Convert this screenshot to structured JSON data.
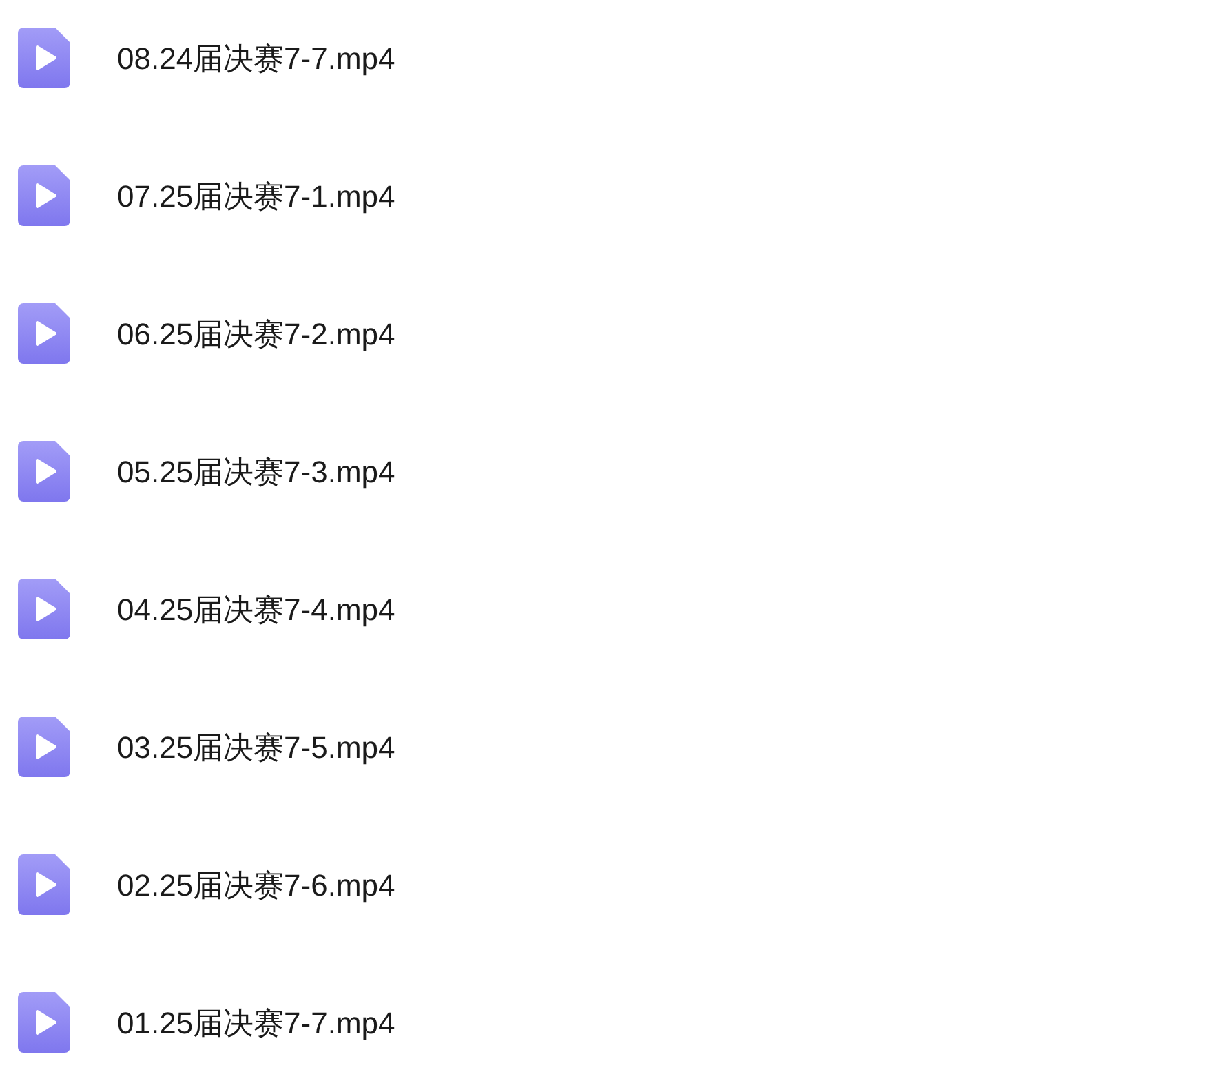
{
  "files": [
    {
      "name": "08.24届决赛7-7.mp4",
      "kind": "video"
    },
    {
      "name": "07.25届决赛7-1.mp4",
      "kind": "video"
    },
    {
      "name": "06.25届决赛7-2.mp4",
      "kind": "video"
    },
    {
      "name": "05.25届决赛7-3.mp4",
      "kind": "video"
    },
    {
      "name": "04.25届决赛7-4.mp4",
      "kind": "video"
    },
    {
      "name": "03.25届决赛7-5.mp4",
      "kind": "video"
    },
    {
      "name": "02.25届决赛7-6.mp4",
      "kind": "video"
    },
    {
      "name": "01.25届决赛7-7.mp4",
      "kind": "video"
    }
  ]
}
